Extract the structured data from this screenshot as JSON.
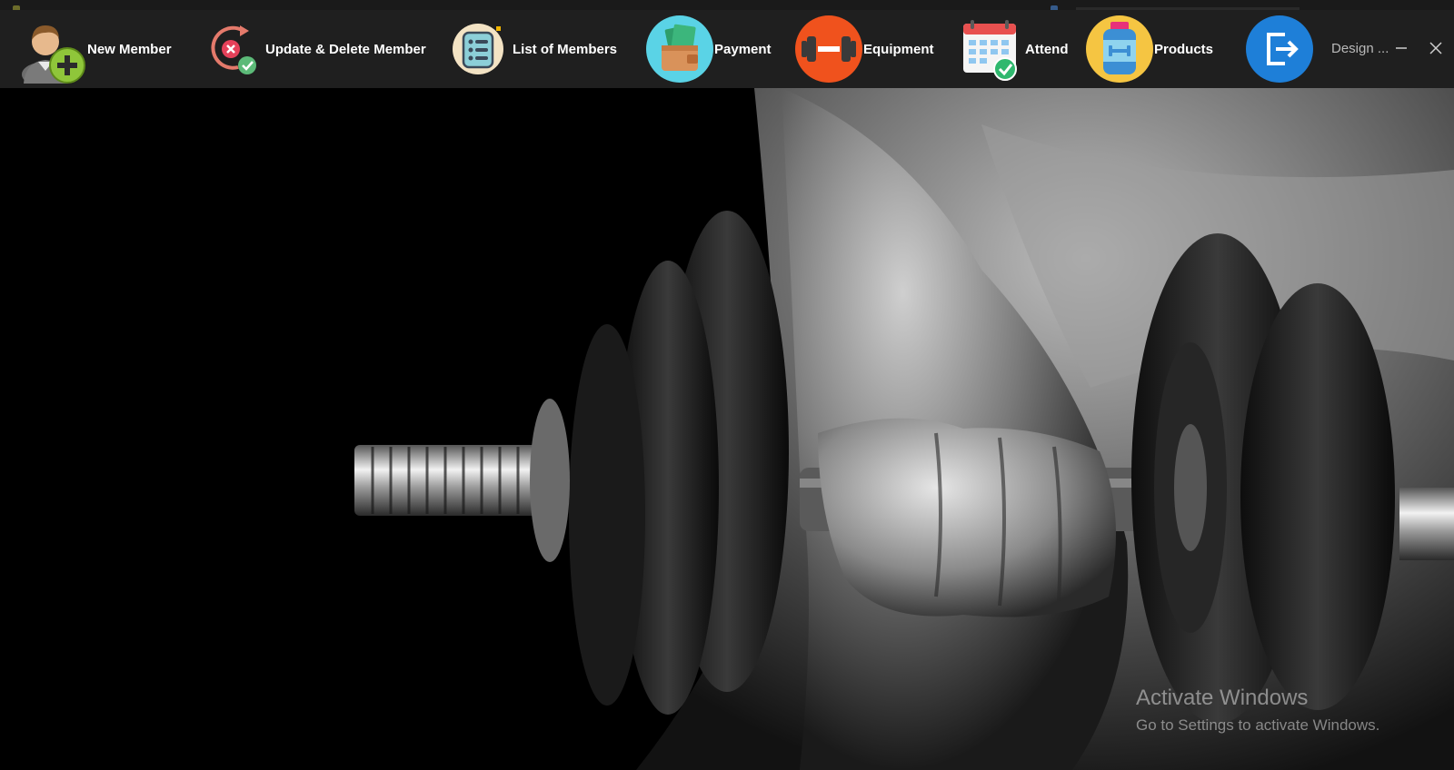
{
  "toolbar": {
    "buttons": [
      {
        "label": "New Member",
        "icon": "add-user-icon"
      },
      {
        "label": "Update & Delete Member",
        "icon": "refresh-check-icon"
      },
      {
        "label": "List of Members",
        "icon": "list-icon"
      },
      {
        "label": "Payment",
        "icon": "wallet-icon"
      },
      {
        "label": "Equipment",
        "icon": "dumbbell-icon"
      },
      {
        "label": "Attend",
        "icon": "calendar-check-icon"
      },
      {
        "label": "Products",
        "icon": "supplement-jar-icon"
      },
      {
        "label": "",
        "icon": "logout-icon"
      }
    ],
    "design_label": "Design ..."
  },
  "window_controls": {
    "minimize_icon": "minimize-icon",
    "close_icon": "close-icon"
  },
  "watermark": {
    "title": "Activate Windows",
    "subtitle": "Go to Settings to activate Windows."
  },
  "colors": {
    "toolbar_bg": "#1f1f1f",
    "payment_circle": "#5ad3e6",
    "equipment_circle": "#f0521d",
    "products_circle": "#f5c542",
    "logout_circle": "#1e7fd8"
  }
}
